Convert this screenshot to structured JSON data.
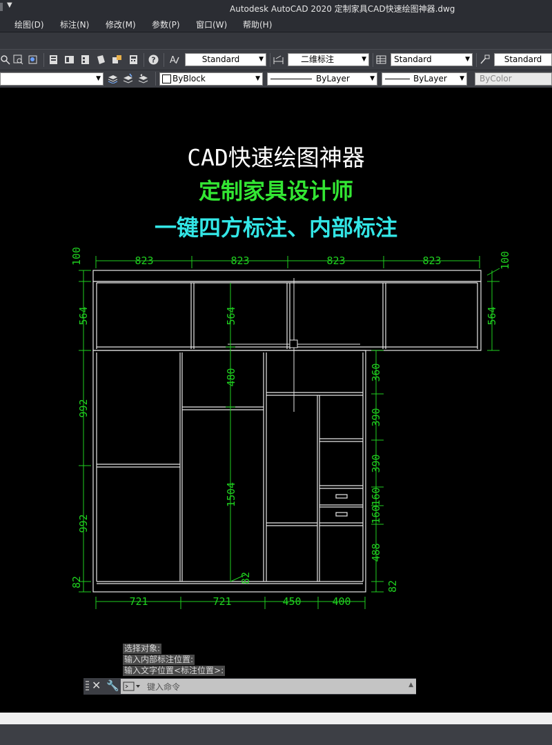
{
  "window": {
    "title": "Autodesk AutoCAD 2020    定制家具CAD快速绘图神器.dwg"
  },
  "menu": [
    "绘图(D)",
    "标注(N)",
    "修改(M)",
    "参数(P)",
    "窗口(W)",
    "帮助(H)"
  ],
  "toolbar": {
    "text_style": "Standard",
    "dim_style": "二维标注",
    "table_style": "Standard",
    "mleader_style": "Standard",
    "color": "ByBlock",
    "linetype": "ByLayer",
    "lineweight": "ByLayer",
    "plotstyle": "ByColor"
  },
  "canvas": {
    "title_line1": "CAD快速绘图神器",
    "title_line2": "定制家具设计师",
    "title_line3": "一键四方标注、内部标注",
    "title_colors": {
      "line1": "#ffffff",
      "line2": "#33e633",
      "line3": "#33e6e6"
    },
    "dim_color": "#1fd11f",
    "dims": {
      "top": [
        "823",
        "823",
        "823",
        "823"
      ],
      "top_left_small": "100",
      "top_right_small": "100",
      "left": [
        "564",
        "992",
        "992",
        "82"
      ],
      "right": [
        "564",
        "360",
        "390",
        "390",
        "160",
        "160",
        "488",
        "82"
      ],
      "inner": [
        "564",
        "480",
        "1504",
        "82"
      ],
      "bottom": [
        "721",
        "721",
        "450",
        "400"
      ]
    }
  },
  "command": {
    "history": [
      "选择对象:",
      "输入内部标注位置:",
      "输入文字位置<标注位置>:"
    ],
    "placeholder": "键入命令"
  }
}
